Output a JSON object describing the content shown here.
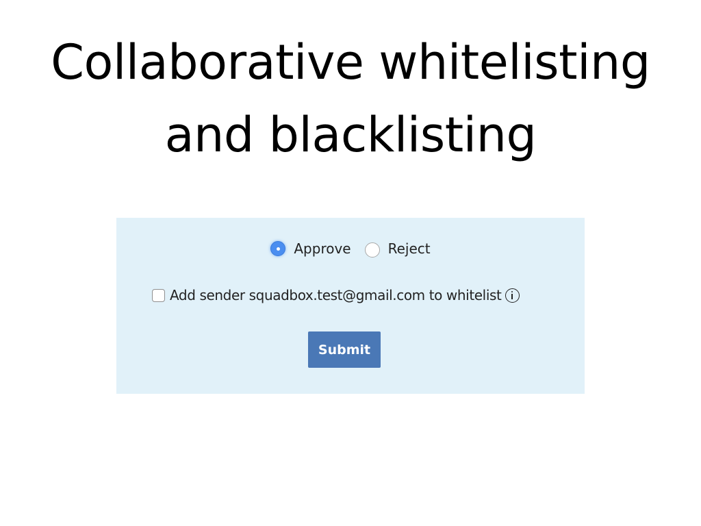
{
  "slide": {
    "title_line1": "Collaborative whitelisting",
    "title_line2": "and blacklisting"
  },
  "form": {
    "background_color": "#e1f1f9",
    "radio_options": [
      {
        "label": "Approve",
        "checked": true
      },
      {
        "label": "Reject",
        "checked": false
      }
    ],
    "checkbox": {
      "label": "Add sender squadbox.test@gmail.com to whitelist",
      "checked": false
    },
    "info_icon": "info-icon",
    "submit_label": "Submit",
    "submit_color": "#4a78b6"
  }
}
